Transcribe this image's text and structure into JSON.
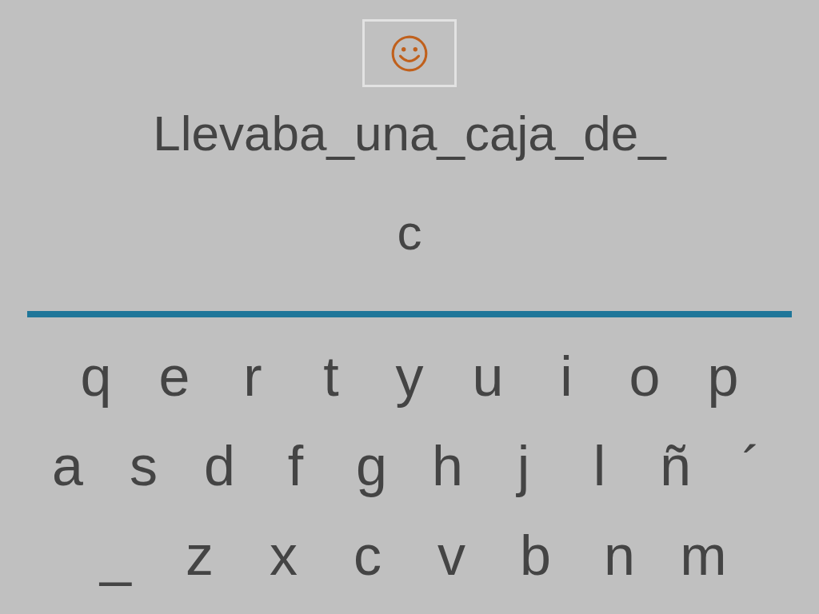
{
  "sentence": "Llevaba_una_caja_de_",
  "answer": "c",
  "keyboard": [
    [
      "q",
      "e",
      "r",
      "t",
      "y",
      "u",
      "i",
      "o",
      "p"
    ],
    [
      "a",
      "s",
      "d",
      "f",
      "g",
      "h",
      "j",
      "l",
      "ñ",
      "´"
    ],
    [
      "_",
      "z",
      "x",
      "c",
      "v",
      "b",
      "n",
      "m"
    ]
  ]
}
